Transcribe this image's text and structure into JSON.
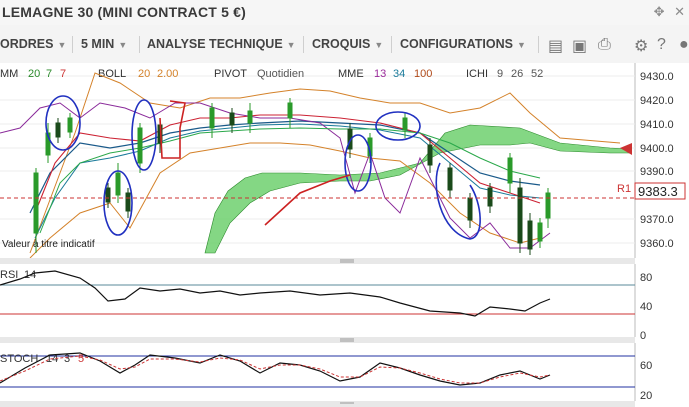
{
  "window": {
    "title": "LEMAGNE 30 (MINI CONTRACT 5 €)",
    "icons": [
      "move-icon",
      "close-icon"
    ]
  },
  "toolbar": {
    "menus": [
      {
        "label": "ORDRES"
      },
      {
        "label": "5 MIN"
      },
      {
        "label": "ANALYSE TECHNIQUE"
      },
      {
        "label": "CROQUIS"
      },
      {
        "label": "CONFIGURATIONS"
      }
    ],
    "tools": [
      "layers-icon",
      "image-icon",
      "print-icon",
      "gear-icon",
      "help-icon",
      "user-icon"
    ]
  },
  "indicators": {
    "mm": {
      "label": "MM",
      "p1": "20",
      "p2": "7",
      "p3": "7"
    },
    "boll": {
      "label": "BOLL",
      "p1": "20",
      "p2": "2.00"
    },
    "pivot": {
      "label": "PIVOT",
      "p1": "Quotidien"
    },
    "mme": {
      "label": "MME",
      "p1": "13",
      "p2": "34",
      "p3": "100"
    },
    "ichi": {
      "label": "ICHI",
      "p1": "9",
      "p2": "26",
      "p3": "52"
    }
  },
  "price_panel": {
    "ticks": [
      "9430.0",
      "9420.0",
      "9410.0",
      "9400.0",
      "9390.0",
      "9370.0",
      "9360.0"
    ],
    "current_price": "9383.3",
    "r1_label": "R1",
    "note": "Valeur à titre indicatif",
    "colors": {
      "up": "#2a9a2a",
      "down": "#1a5a1a",
      "cloud": "#66cc66",
      "bollinger": "#d4822a",
      "price_box": "#cc3333"
    }
  },
  "rsi_panel": {
    "label": "RSI",
    "p1": "14",
    "ticks": [
      "80",
      "40",
      "0"
    ]
  },
  "stoch_panel": {
    "label": "STOCH",
    "p1": "14",
    "p2": "3",
    "p3": "5",
    "ticks": [
      "60",
      "20"
    ]
  }
}
